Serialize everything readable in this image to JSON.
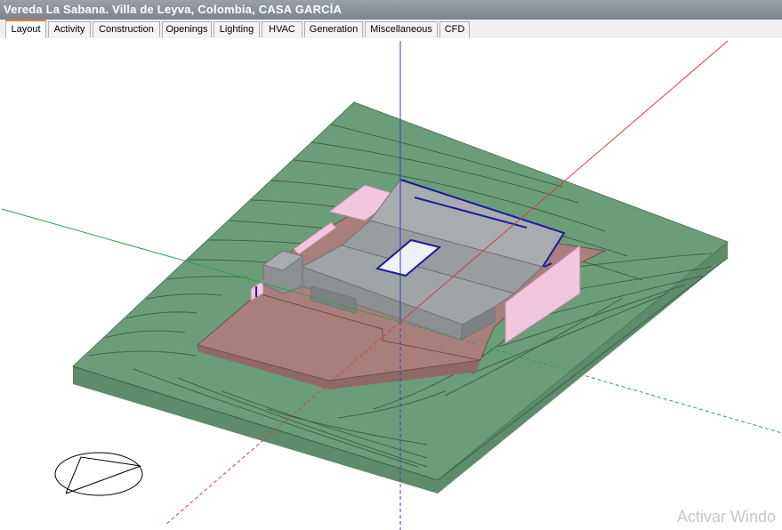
{
  "window": {
    "title": "Vereda La Sabana. Villa de Leyva, Colombia, CASA GARCÍA"
  },
  "tabs": [
    {
      "label": "Layout",
      "active": true
    },
    {
      "label": "Activity",
      "active": false
    },
    {
      "label": "Construction",
      "active": false
    },
    {
      "label": "Openings",
      "active": false
    },
    {
      "label": "Lighting",
      "active": false
    },
    {
      "label": "HVAC",
      "active": false
    },
    {
      "label": "Generation",
      "active": false
    },
    {
      "label": "Miscellaneous",
      "active": false
    },
    {
      "label": "CFD",
      "active": false
    }
  ],
  "overlay": {
    "watermark": "Activar Windo"
  },
  "colors": {
    "terrain": "#6b9e78",
    "terrain_side": "#5e8c6a",
    "terrain_contour": "#3f5f47",
    "slab": "#a97f7c",
    "building_roof": "#a8acae",
    "building_wall": "#8c9092",
    "partition": "#f2c6dc",
    "highlight_line": "#1a1aa0",
    "axis_x": "#d04040",
    "axis_y": "#30a050",
    "axis_z": "#3040c0",
    "active_tab_accent": "#e07a2e"
  },
  "icons": [
    "compass-icon"
  ]
}
